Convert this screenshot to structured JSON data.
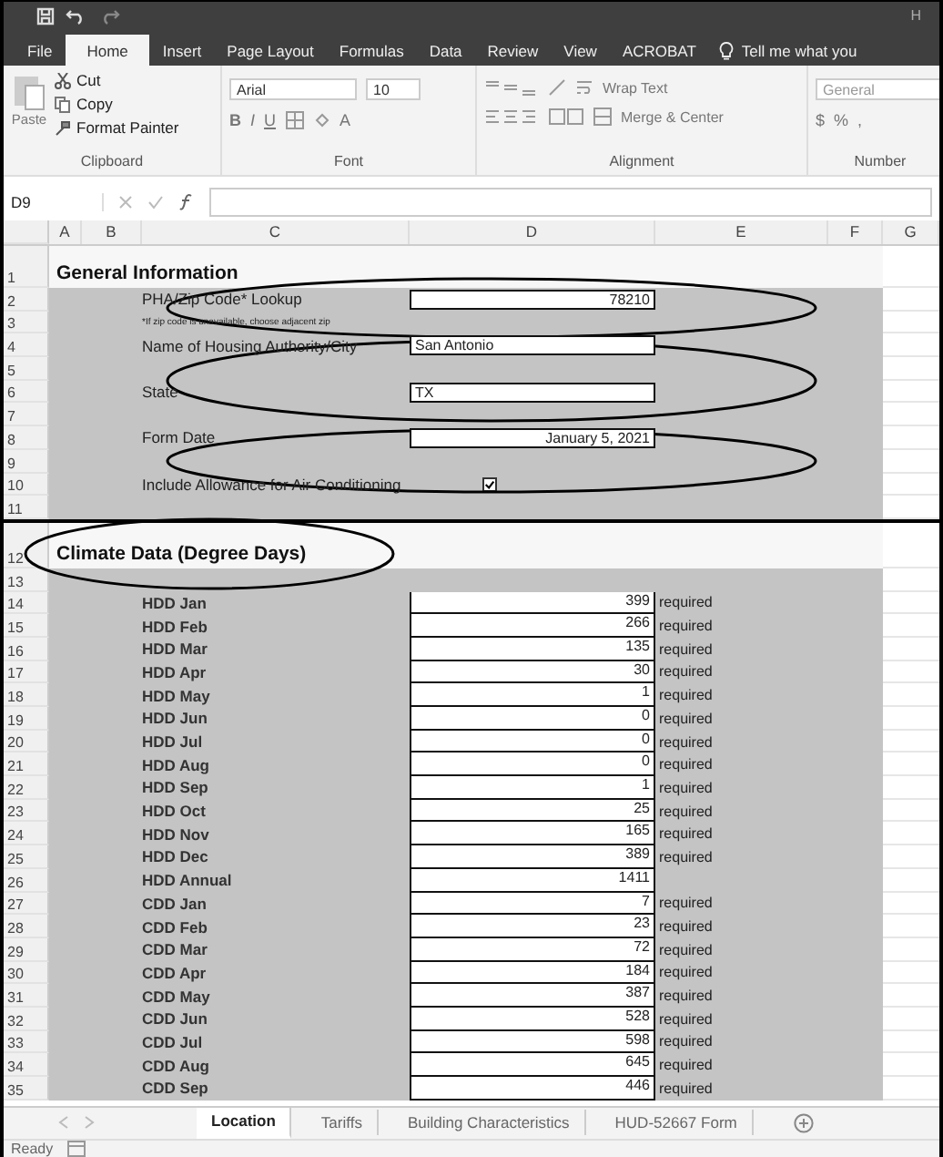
{
  "title_bar": {
    "text": "H"
  },
  "ribbon_tabs": [
    {
      "label": "File",
      "selected": false
    },
    {
      "label": "Home",
      "selected": true
    },
    {
      "label": "Insert",
      "selected": false
    },
    {
      "label": "Page Layout",
      "selected": false
    },
    {
      "label": "Formulas",
      "selected": false
    },
    {
      "label": "Data",
      "selected": false
    },
    {
      "label": "Review",
      "selected": false
    },
    {
      "label": "View",
      "selected": false
    },
    {
      "label": "ACROBAT",
      "selected": false
    }
  ],
  "tell_me": "Tell me what you",
  "clipboard": {
    "paste": "Paste",
    "cut": "Cut",
    "copy": "Copy",
    "format_painter": "Format Painter",
    "label": "Clipboard"
  },
  "font": {
    "name": "Arial",
    "size": "10",
    "bold": "B",
    "italic": "I",
    "underline": "U",
    "color_letter": "A",
    "label": "Font"
  },
  "alignment": {
    "wrap": "Wrap Text",
    "merge": "Merge & Center",
    "label": "Alignment"
  },
  "number": {
    "format": "General",
    "currency": "$",
    "percent": "%",
    "comma": ",",
    "label": "Number"
  },
  "formula_bar": {
    "cell": "D9"
  },
  "columns": [
    "A",
    "B",
    "C",
    "D",
    "E",
    "F",
    "G"
  ],
  "rows": [
    {
      "num": "1",
      "kind": "section",
      "label": "General Information"
    },
    {
      "num": "2",
      "kind": "number_field",
      "label": "PHA/Zip Code* Lookup",
      "value": "78210"
    },
    {
      "num": "3",
      "kind": "note",
      "label": "*If zip code is unavailable, choose adjacent zip"
    },
    {
      "num": "4",
      "kind": "text_field",
      "label": "Name of Housing Authority/City",
      "value": "San Antonio"
    },
    {
      "num": "5",
      "kind": "blank"
    },
    {
      "num": "6",
      "kind": "text_field",
      "label": "State",
      "value": "TX"
    },
    {
      "num": "7",
      "kind": "blank"
    },
    {
      "num": "8",
      "kind": "number_field",
      "label": "Form Date",
      "value": "January 5, 2021"
    },
    {
      "num": "9",
      "kind": "blank"
    },
    {
      "num": "10",
      "kind": "check",
      "label": "Include Allowance for Air Conditioning",
      "checked": true
    },
    {
      "num": "11",
      "kind": "blank"
    },
    {
      "num": "12",
      "kind": "section",
      "label": "Climate Data (Degree Days)"
    },
    {
      "num": "13",
      "kind": "blank"
    },
    {
      "num": "14",
      "kind": "data",
      "label": "HDD Jan",
      "value": "399",
      "note": "required"
    },
    {
      "num": "15",
      "kind": "data",
      "label": "HDD Feb",
      "value": "266",
      "note": "required"
    },
    {
      "num": "16",
      "kind": "data",
      "label": "HDD Mar",
      "value": "135",
      "note": "required"
    },
    {
      "num": "17",
      "kind": "data",
      "label": "HDD Apr",
      "value": "30",
      "note": "required"
    },
    {
      "num": "18",
      "kind": "data",
      "label": "HDD May",
      "value": "1",
      "note": "required"
    },
    {
      "num": "19",
      "kind": "data",
      "label": "HDD Jun",
      "value": "0",
      "note": "required"
    },
    {
      "num": "20",
      "kind": "data",
      "label": "HDD Jul",
      "value": "0",
      "note": "required"
    },
    {
      "num": "21",
      "kind": "data",
      "label": "HDD Aug",
      "value": "0",
      "note": "required"
    },
    {
      "num": "22",
      "kind": "data",
      "label": "HDD Sep",
      "value": "1",
      "note": "required"
    },
    {
      "num": "23",
      "kind": "data",
      "label": "HDD Oct",
      "value": "25",
      "note": "required"
    },
    {
      "num": "24",
      "kind": "data",
      "label": "HDD Nov",
      "value": "165",
      "note": "required"
    },
    {
      "num": "25",
      "kind": "data",
      "label": "HDD Dec",
      "value": "389",
      "note": "required"
    },
    {
      "num": "26",
      "kind": "data",
      "label": "HDD Annual",
      "value": "1411"
    },
    {
      "num": "27",
      "kind": "data",
      "label": "CDD Jan",
      "value": "7",
      "note": "required"
    },
    {
      "num": "28",
      "kind": "data",
      "label": "CDD Feb",
      "value": "23",
      "note": "required"
    },
    {
      "num": "29",
      "kind": "data",
      "label": "CDD Mar",
      "value": "72",
      "note": "required"
    },
    {
      "num": "30",
      "kind": "data",
      "label": "CDD Apr",
      "value": "184",
      "note": "required"
    },
    {
      "num": "31",
      "kind": "data",
      "label": "CDD May",
      "value": "387",
      "note": "required"
    },
    {
      "num": "32",
      "kind": "data",
      "label": "CDD Jun",
      "value": "528",
      "note": "required"
    },
    {
      "num": "33",
      "kind": "data",
      "label": "CDD Jul",
      "value": "598",
      "note": "required"
    },
    {
      "num": "34",
      "kind": "data",
      "label": "CDD Aug",
      "value": "645",
      "note": "required"
    },
    {
      "num": "35",
      "kind": "data",
      "label": "CDD Sep",
      "value": "446",
      "note": "required"
    }
  ],
  "sheet_tabs": [
    {
      "label": "Location",
      "selected": true
    },
    {
      "label": "Tariffs",
      "selected": false
    },
    {
      "label": "Building Characteristics",
      "selected": false
    },
    {
      "label": "HUD-52667 Form",
      "selected": false
    }
  ],
  "status": "Ready"
}
